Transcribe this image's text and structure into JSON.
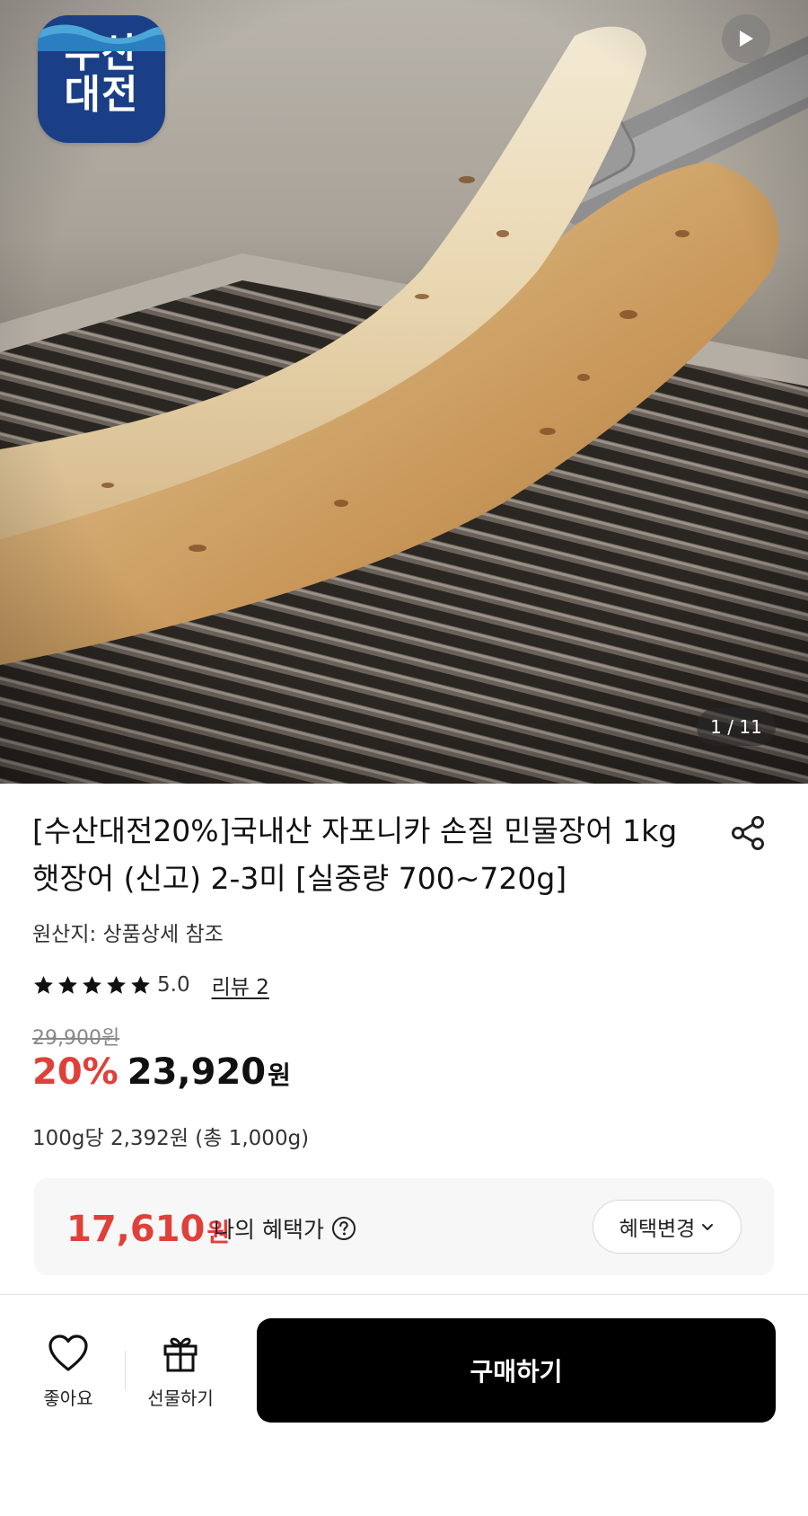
{
  "brand": {
    "badge_line1": "수산",
    "badge_line2": "대전",
    "badge_color": "#1b3f86"
  },
  "gallery": {
    "counter": "1 / 11"
  },
  "product": {
    "title": "[수산대전20%]국내산 자포니카 손질 민물장어 1kg 햇장어 (신고) 2-3미 [실중량 700~720g]",
    "origin": "원산지: 상품상세 참조",
    "rating": {
      "stars": 5,
      "value": "5.0",
      "review_label": "리뷰 2"
    },
    "original_price": "29,900원",
    "discount": "20%",
    "price": "23,920",
    "price_unit": "원",
    "unit_price": "100g당 2,392원 (총 1,000g)"
  },
  "benefit": {
    "price": "17,610",
    "price_unit": "원",
    "label": "나의 혜택가",
    "change_button": "혜택변경"
  },
  "bottom_bar": {
    "like_label": "좋아요",
    "gift_label": "선물하기",
    "buy_label": "구매하기"
  },
  "colors": {
    "accent_red": "#e0403a",
    "buy_button": "#000000"
  }
}
